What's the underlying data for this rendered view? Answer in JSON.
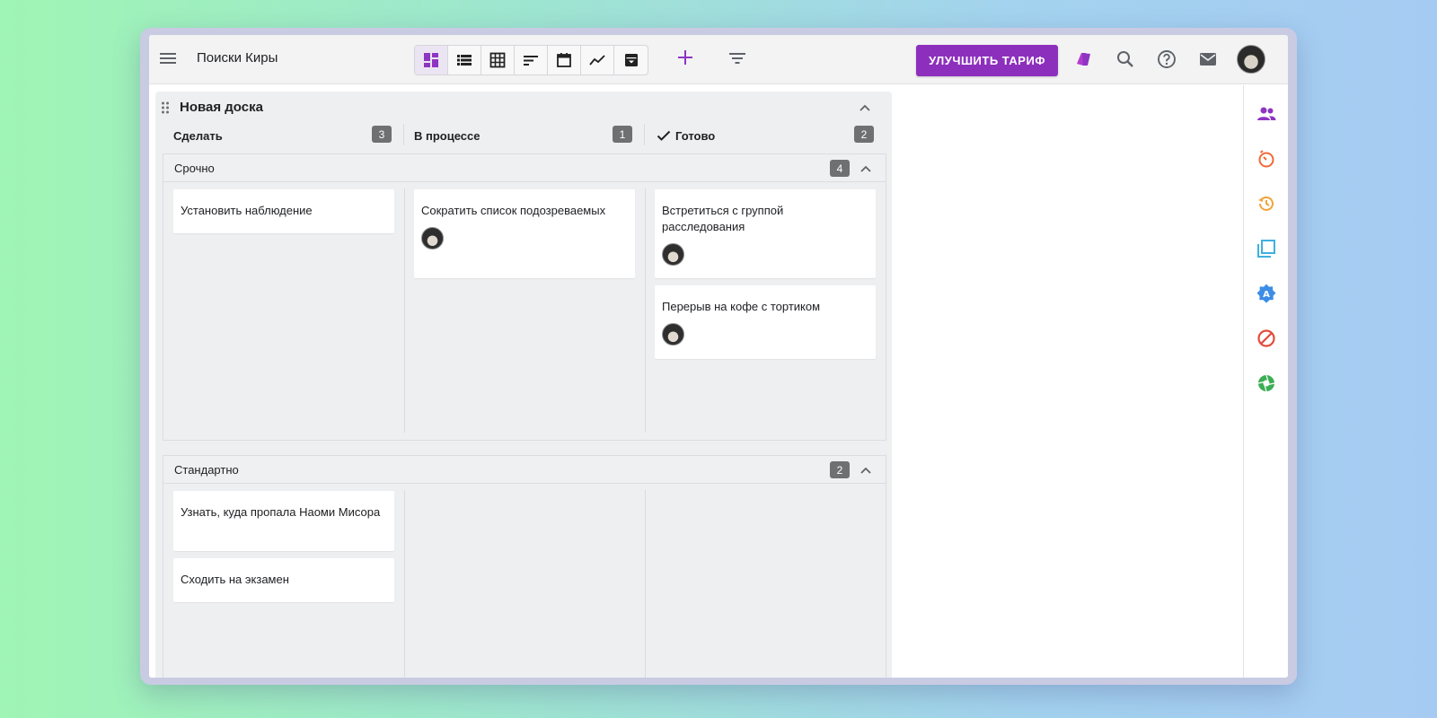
{
  "toolbar": {
    "board_title": "Поиски Киры",
    "upgrade_label": "УЛУЧШИТЬ ТАРИФ",
    "views": [
      "board-view",
      "list-view",
      "table-view",
      "sort-view",
      "calendar-view",
      "chart-view",
      "archive-view"
    ],
    "active_view": "board-view"
  },
  "board": {
    "name": "Новая доска",
    "columns": [
      {
        "title": "Сделать",
        "count": "3",
        "done_check": false
      },
      {
        "title": "В процессе",
        "count": "1",
        "done_check": false
      },
      {
        "title": "Готово",
        "count": "2",
        "done_check": true
      }
    ],
    "lanes": [
      {
        "title": "Срочно",
        "count": "4",
        "cards": [
          [
            {
              "title": "Установить наблюдение",
              "avatar": false
            }
          ],
          [
            {
              "title": "Сократить список подозреваемых",
              "avatar": true
            }
          ],
          [
            {
              "title": "Встретиться с группой расследования",
              "avatar": true
            },
            {
              "title": "Перерыв на кофе с тортиком",
              "avatar": true
            }
          ]
        ]
      },
      {
        "title": "Стандартно",
        "count": "2",
        "cards": [
          [
            {
              "title": "Узнать, куда пропала Наоми Мисора",
              "avatar": false
            },
            {
              "title": "Сходить на экзамен",
              "avatar": false
            }
          ],
          [],
          []
        ]
      }
    ]
  },
  "colors": {
    "accent": "#8d2fbd",
    "rail_team": "#8e35c2",
    "rail_timer": "#ef6a3a",
    "rail_history": "#f2a33a",
    "rail_copy": "#3fb0e0",
    "rail_badge": "#3c8de8",
    "rail_block": "#e24a3b",
    "rail_aperture": "#3cae55"
  }
}
